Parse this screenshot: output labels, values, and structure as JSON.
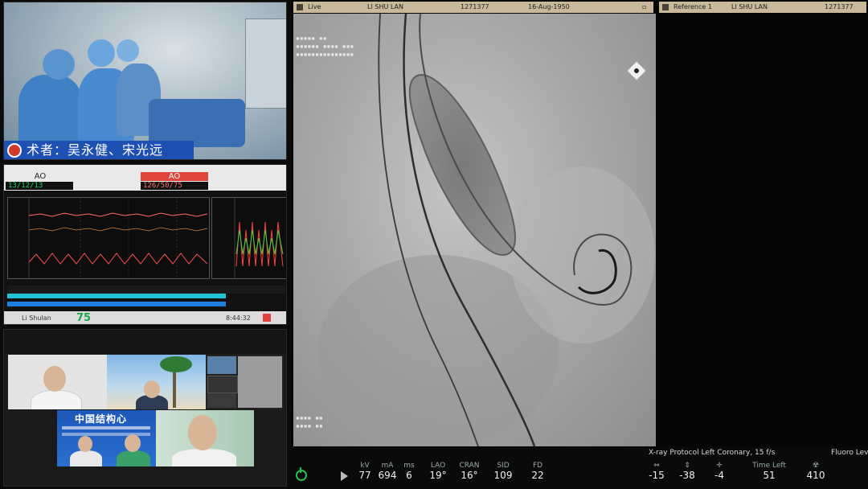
{
  "or_camera": {
    "caption": "术者：吴永健、宋光远"
  },
  "monitor": {
    "left_label": "AO",
    "right_label": "AO",
    "left_value": "13/12/13",
    "right_value": "126/50/75",
    "pulse": "75",
    "patient": "Li Shulan",
    "clock": "8:44:32"
  },
  "video_conf": {
    "banner_title": "中国结构心"
  },
  "viewer": {
    "top_bar": {
      "live_label": "Live",
      "patient": "LI SHU LAN",
      "patient_id": "1271377",
      "dob": "16-Aug-1950",
      "reference_label": "Reference 1",
      "ref_patient": "LI SHU LAN",
      "ref_patient_id": "1271377"
    },
    "protocol": "X-ray Protocol Left Coronary, 15 f/s",
    "fluoro_label": "Fluoro Lev",
    "params": [
      {
        "label": "kV",
        "value": "77"
      },
      {
        "label": "mA",
        "value": "694"
      },
      {
        "label": "ms",
        "value": "6"
      },
      {
        "label": "LAO",
        "value": "19°"
      },
      {
        "label": "CRAN",
        "value": "16°"
      },
      {
        "label": "SID",
        "value": "109"
      },
      {
        "label": "FD",
        "value": "22"
      },
      {
        "label": "",
        "value": "-15"
      },
      {
        "label": "",
        "value": "-38"
      },
      {
        "label": "",
        "value": "-4"
      },
      {
        "label": "Time Left",
        "value": "51"
      },
      {
        "label": "",
        "value": "410"
      }
    ]
  },
  "colors": {
    "monitor_green": "#1fd25a",
    "monitor_red": "#ff7070",
    "caption_blue": "#1e4fb3",
    "viewer_bar": "#c8b99a",
    "power_green": "#23c24c"
  }
}
